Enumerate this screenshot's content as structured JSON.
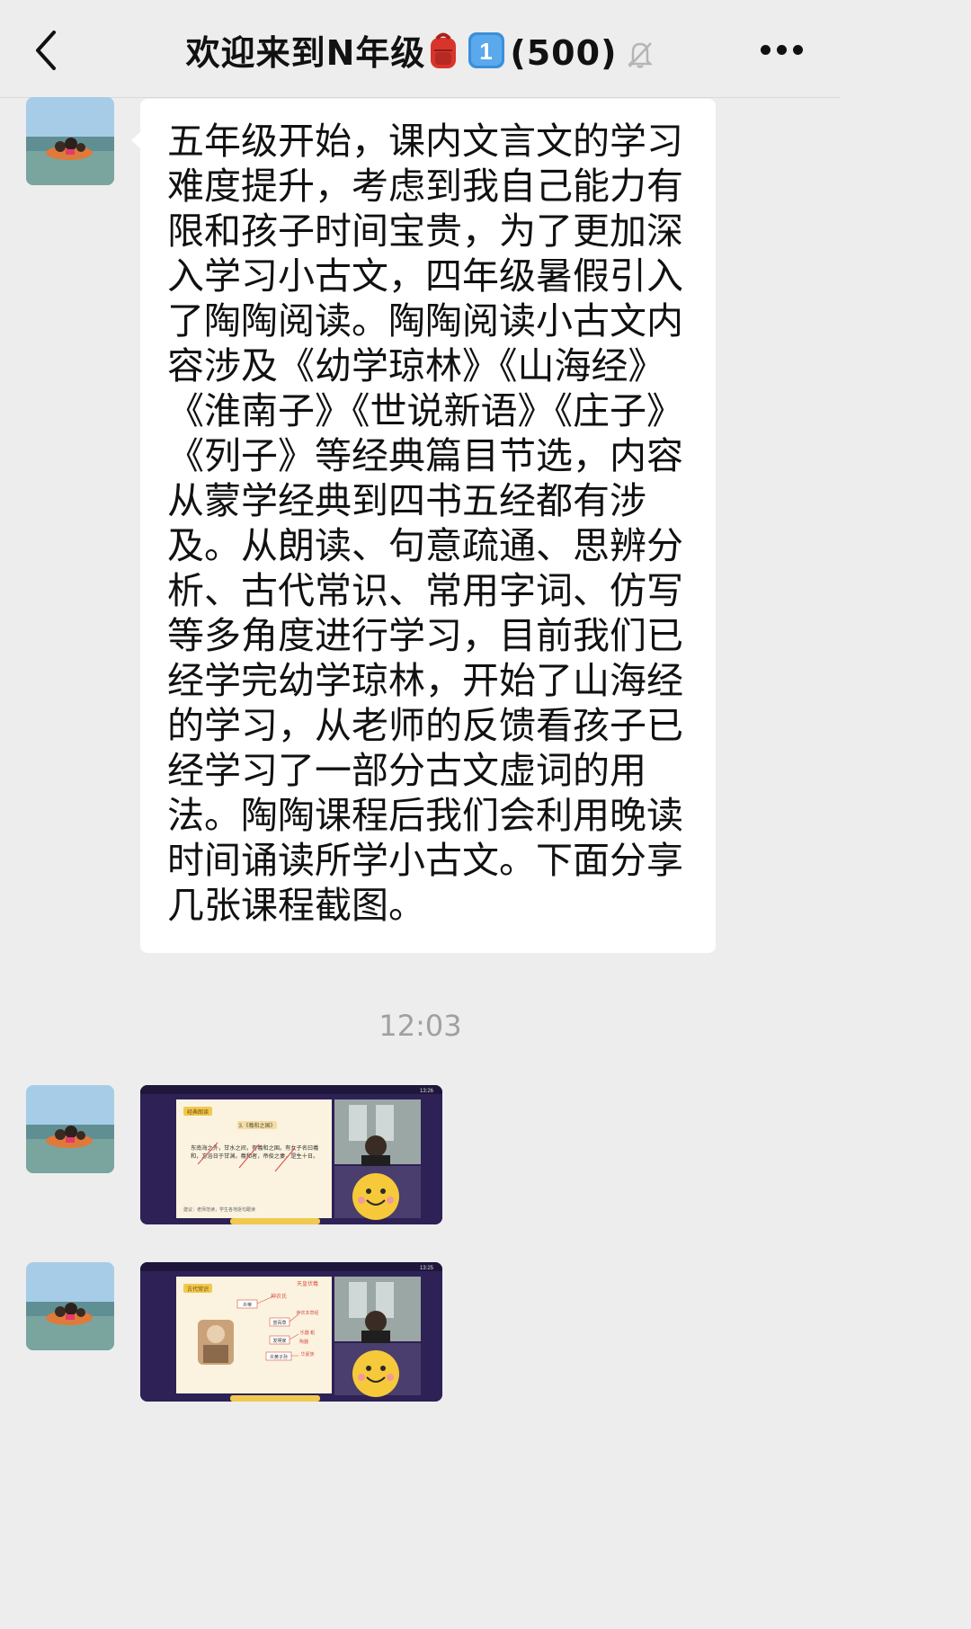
{
  "header": {
    "title": "欢迎来到N年级",
    "member_count": "(500)",
    "badge_digit": "1"
  },
  "messages": [
    {
      "type": "text",
      "text": "五年级开始，课内文言文的学习难度提升，考虑到我自己能力有限和孩子时间宝贵，为了更加深入学习小古文，四年级暑假引入了陶陶阅读。陶陶阅读小古文内容涉及《幼学琼林》《山海经》《淮南子》《世说新语》《庄子》《列子》等经典篇目节选，内容从蒙学经典到四书五经都有涉及。从朗读、句意疏通、思辨分析、古代常识、常用字词、仿写等多角度进行学习，目前我们已经学完幼学琼林，开始了山海经的学习，从老师的反馈看孩子已经学习了一部分古文虚词的用法。陶陶课程后我们会利用晚读时间诵读所学小古文。下面分享几张课程截图。"
    }
  ],
  "timestamp": "12:03",
  "images": [
    {
      "status_time": "13:26",
      "slide_tag": "经典朗读",
      "slide_title": "3.《羲和之国》",
      "slide_body": "东南海之外，甘水之间，有羲和之国。有女子名曰羲和，方浴日于甘渊。羲和者，帝俊之妻，是生十日。",
      "slide_footer": "建议：老师范读，学生各地逐句跟读"
    },
    {
      "status_time": "13:25",
      "slide_tag": "古代常识",
      "nodes": [
        "天皇伏羲",
        "神农氏",
        "炎帝",
        "尝百草",
        "神农本草经",
        "发明家",
        "乐器 耜",
        "陶器",
        "炎黄子孙",
        "华夏族"
      ]
    }
  ]
}
